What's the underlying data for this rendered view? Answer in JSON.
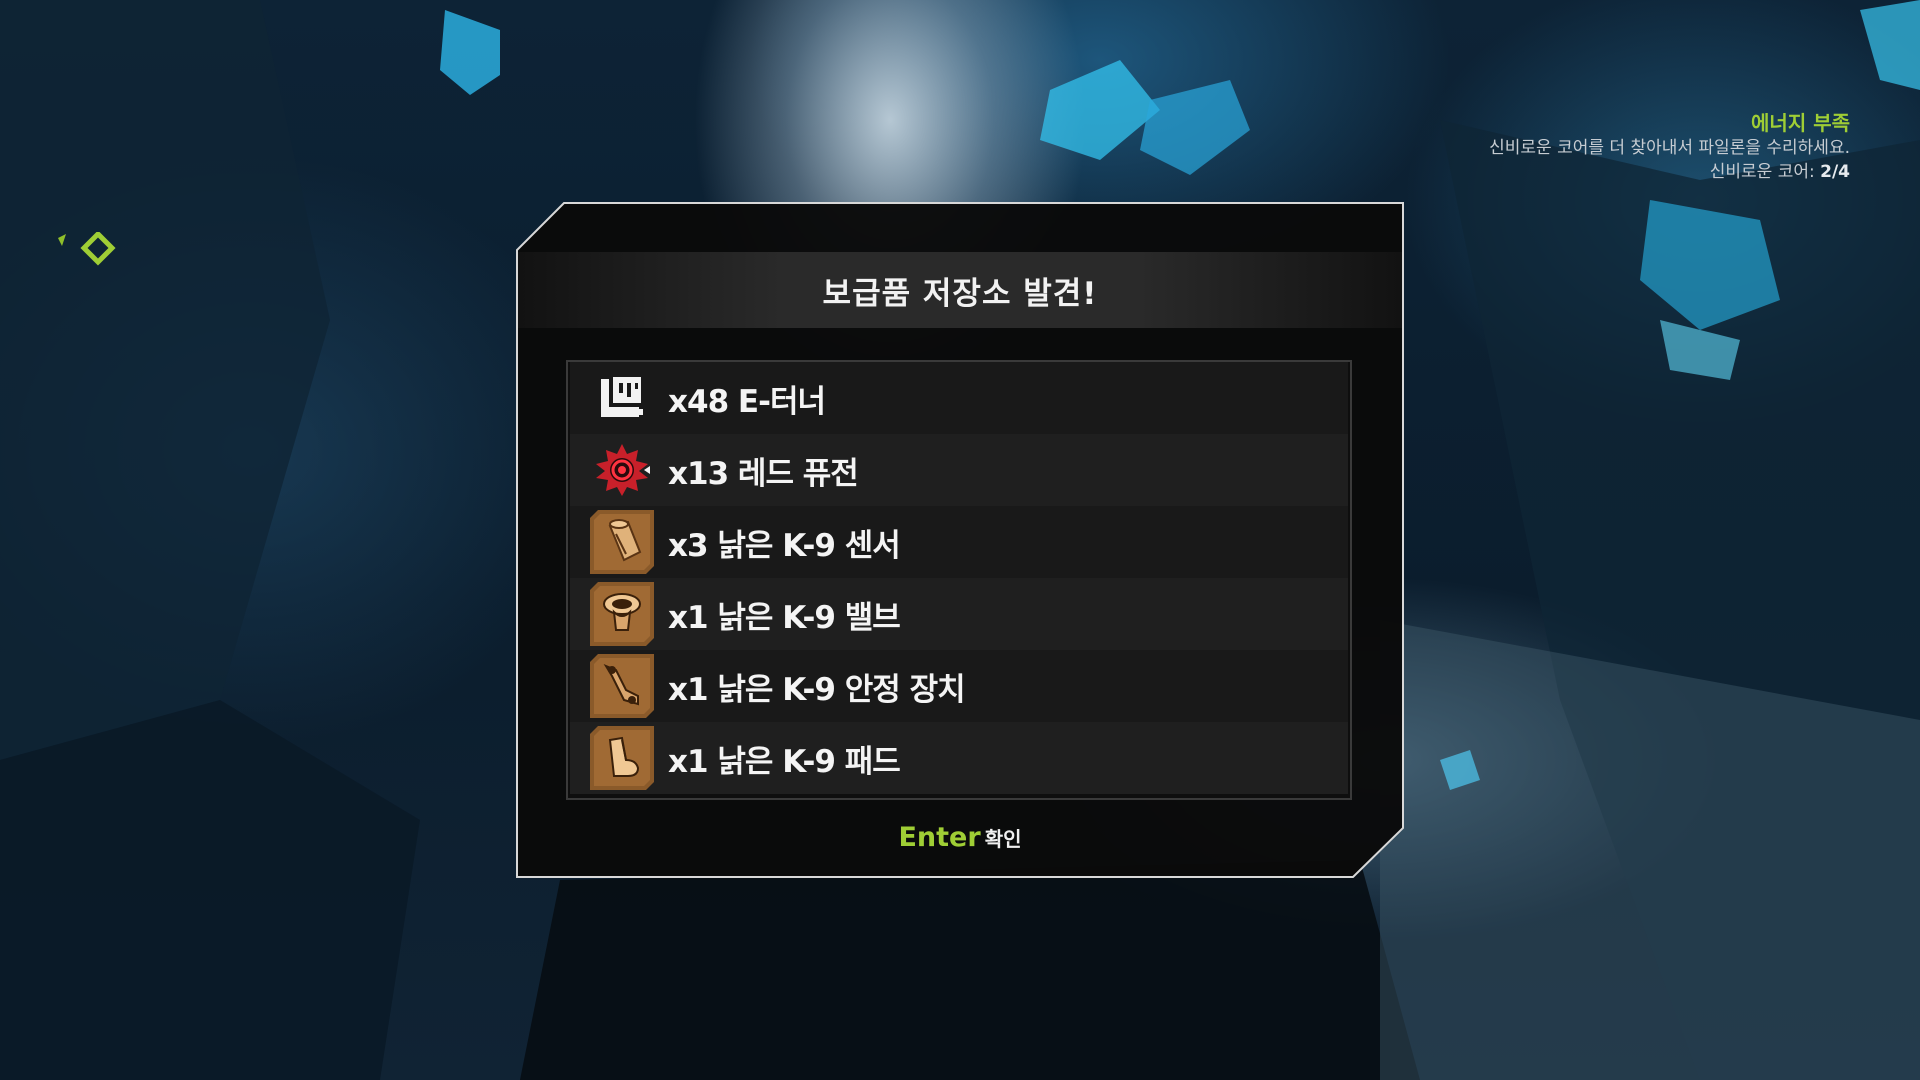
{
  "objective": {
    "title": "에너지 부족",
    "description": "신비로운 코어를 더 찾아내서 파일론을 수리하세요.",
    "counter_label": "신비로운 코어:",
    "counter_value": "2/4"
  },
  "dialog": {
    "title": "보급품 저장소 발견!",
    "items": [
      {
        "label": "x48 E-터너",
        "icon": "e-tuner-icon"
      },
      {
        "label": "x13 레드 퓨전",
        "icon": "red-fusion-icon"
      },
      {
        "label": "x3 낡은 K-9 센서",
        "icon": "k9-sensor-icon"
      },
      {
        "label": "x1 낡은 K-9 밸브",
        "icon": "k9-valve-icon"
      },
      {
        "label": "x1 낡은 K-9 안정 장치",
        "icon": "k9-stabilizer-icon"
      },
      {
        "label": "x1 낡은 K-9 패드",
        "icon": "k9-pad-icon"
      }
    ],
    "confirm_key": "Enter",
    "confirm_label": "확인"
  },
  "colors": {
    "accent": "#9fce35",
    "panel": "#0a0a0a",
    "part_bronze": "#8a5a2a"
  }
}
